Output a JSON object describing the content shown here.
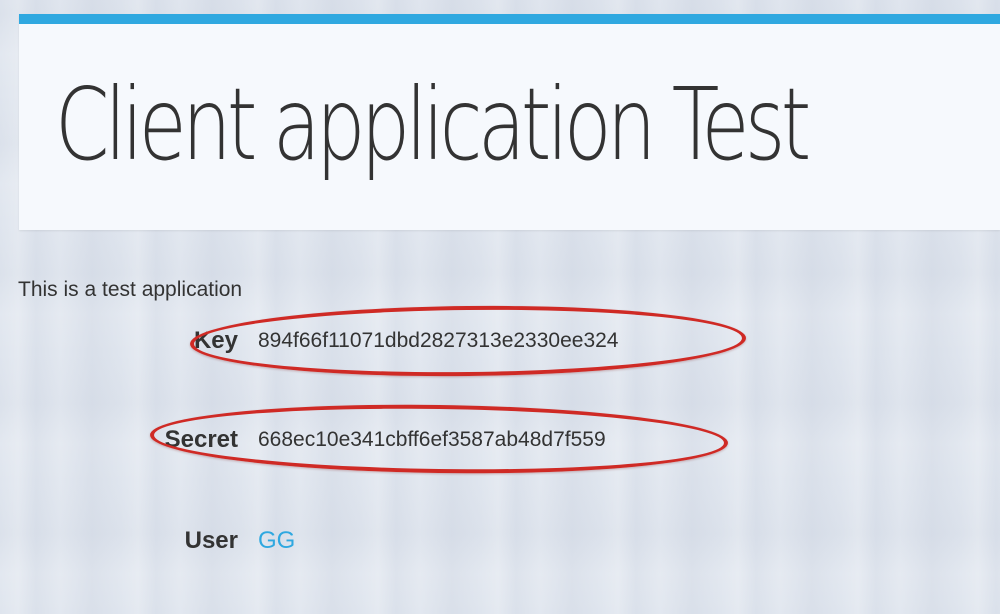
{
  "header": {
    "title": "Client application Test"
  },
  "description": "This is a test application",
  "fields": {
    "key": {
      "label": "Key",
      "value": "894f66f11071dbd2827313e2330ee324"
    },
    "secret": {
      "label": "Secret",
      "value": "668ec10e341cbff6ef3587ab48d7f559"
    },
    "user": {
      "label": "User",
      "value": "GG"
    }
  },
  "colors": {
    "accent": "#2fa8e0",
    "highlight": "#cf2a25",
    "text": "#333333"
  }
}
